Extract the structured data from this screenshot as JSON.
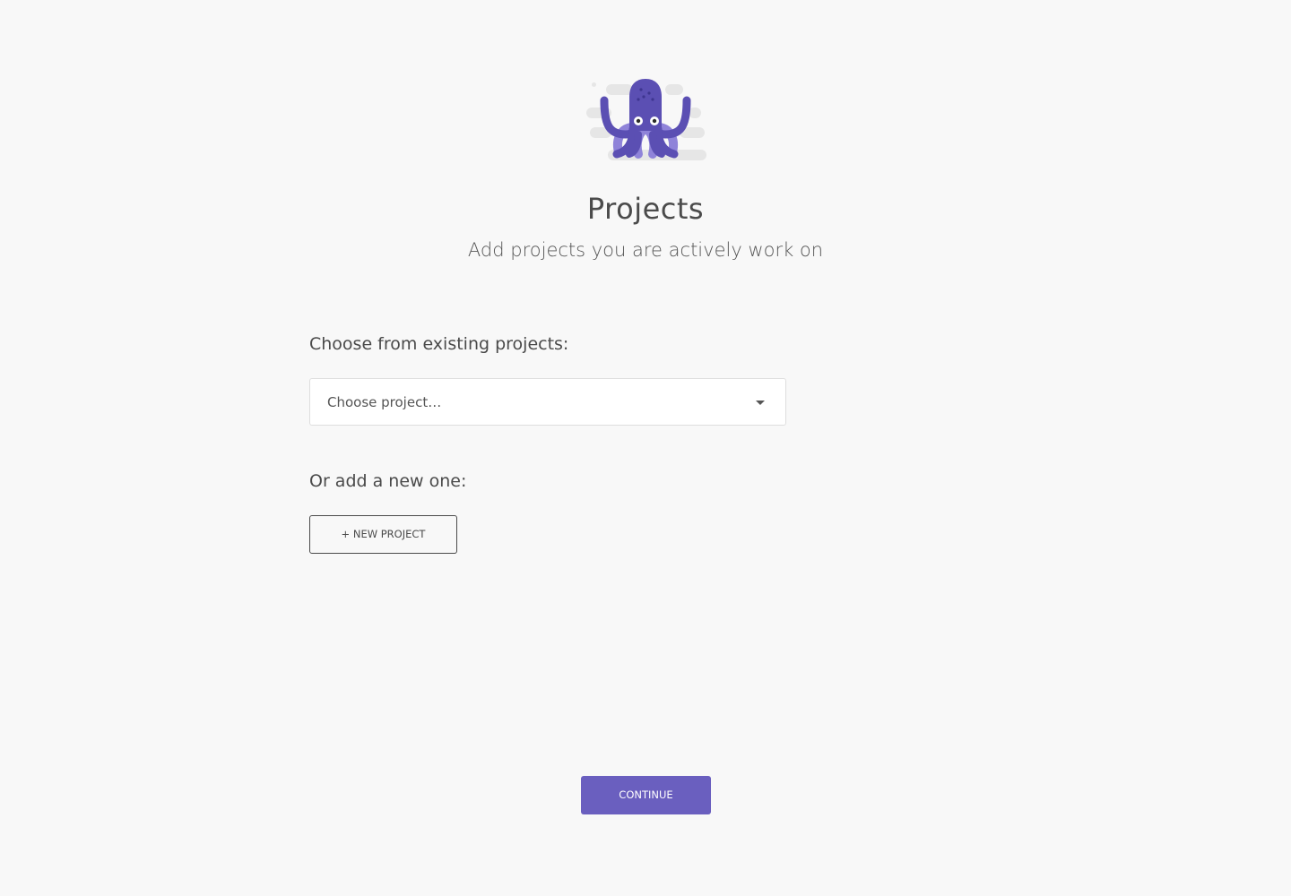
{
  "header": {
    "title": "Projects",
    "subtitle": "Add projects you are actively work on",
    "mascot_icon": "octopus-mascot-icon"
  },
  "existing": {
    "label": "Choose from existing projects:",
    "select_placeholder": "Choose project…"
  },
  "new": {
    "label": "Or add a new one:",
    "button_label": "+ NEW PROJECT"
  },
  "footer": {
    "continue_label": "CONTINUE"
  },
  "colors": {
    "accent": "#6a5fbf",
    "mascot_dark": "#5b4fb3",
    "mascot_light": "#8f83d9",
    "background": "#f8f8f8"
  }
}
